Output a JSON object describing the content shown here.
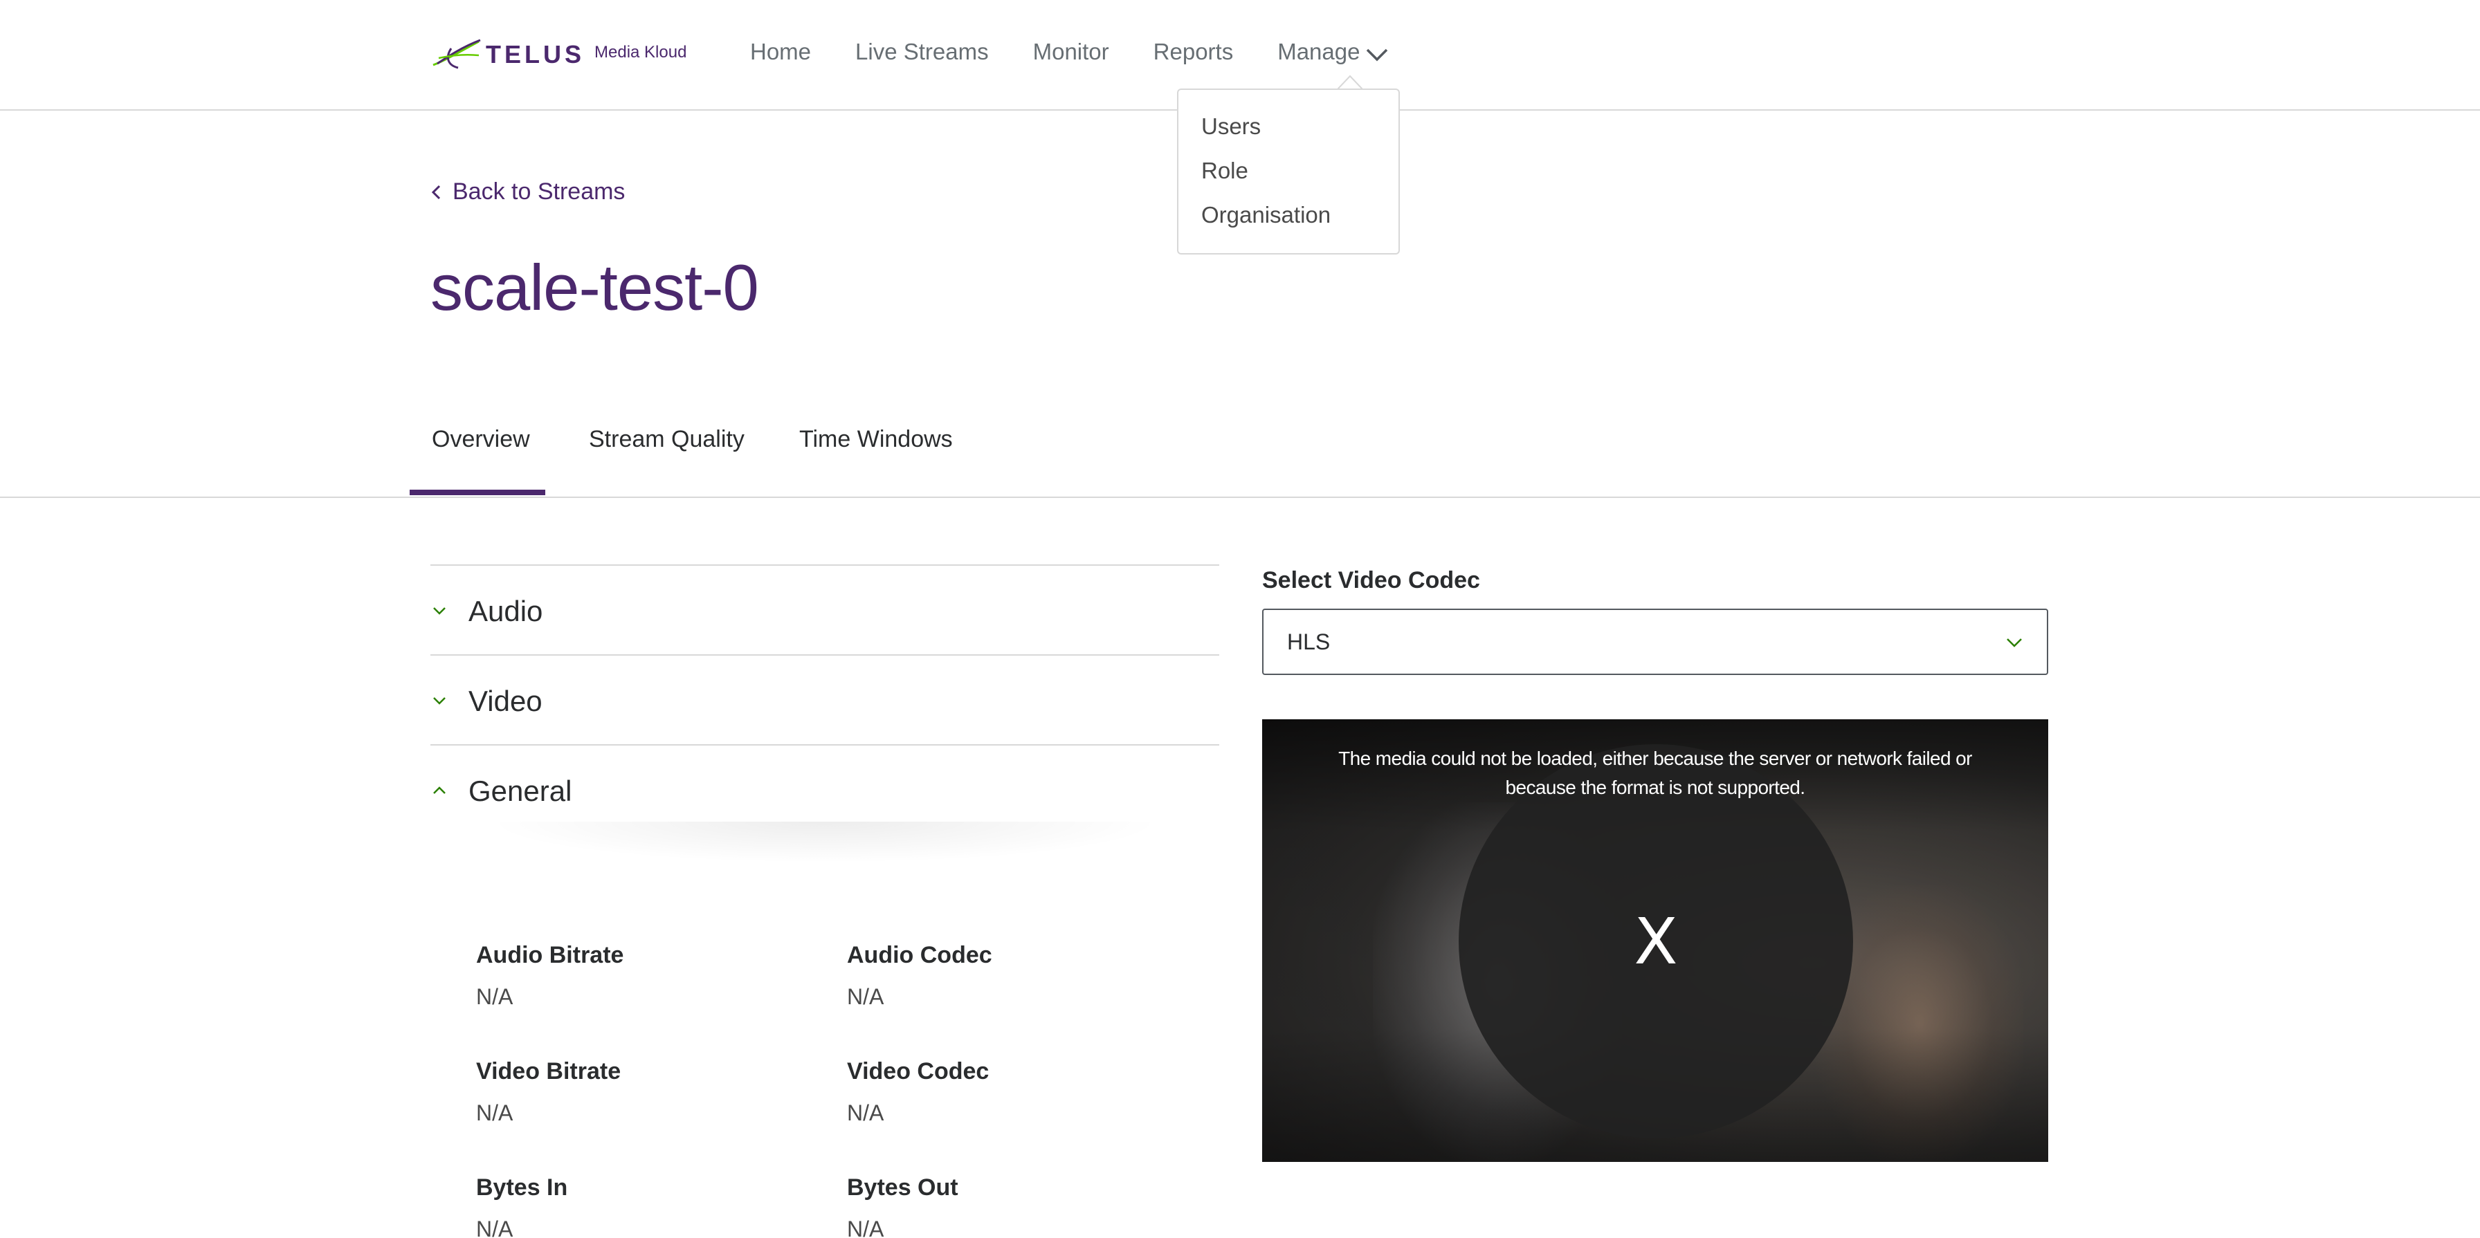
{
  "header": {
    "brand": "TELUS",
    "product": "Media Kloud",
    "nav": [
      "Home",
      "Live Streams",
      "Monitor",
      "Reports",
      "Manage"
    ]
  },
  "manage_menu": {
    "items": [
      "Users",
      "Role",
      "Organisation"
    ]
  },
  "back_link": "Back to Streams",
  "page_title": "scale-test-0",
  "tabs": [
    "Overview",
    "Stream Quality",
    "Time Windows"
  ],
  "active_tab": "Overview",
  "accordion": [
    {
      "label": "Audio",
      "expanded": false
    },
    {
      "label": "Video",
      "expanded": false
    },
    {
      "label": "General",
      "expanded": true
    }
  ],
  "general_details": [
    {
      "label": "Audio Bitrate",
      "value": "N/A"
    },
    {
      "label": "Audio Codec",
      "value": "N/A"
    },
    {
      "label": "Video Bitrate",
      "value": "N/A"
    },
    {
      "label": "Video Codec",
      "value": "N/A"
    },
    {
      "label": "Bytes In",
      "value": "N/A"
    },
    {
      "label": "Bytes Out",
      "value": "N/A"
    }
  ],
  "codec": {
    "label": "Select Video Codec",
    "selected": "HLS"
  },
  "player": {
    "error_message": "The media could not be loaded, either because the server or network failed or because the format is not supported.",
    "error_icon": "X"
  },
  "colors": {
    "brand_purple": "#4b286d",
    "accent_green": "#2b8000",
    "divider": "#d8d8d8"
  }
}
